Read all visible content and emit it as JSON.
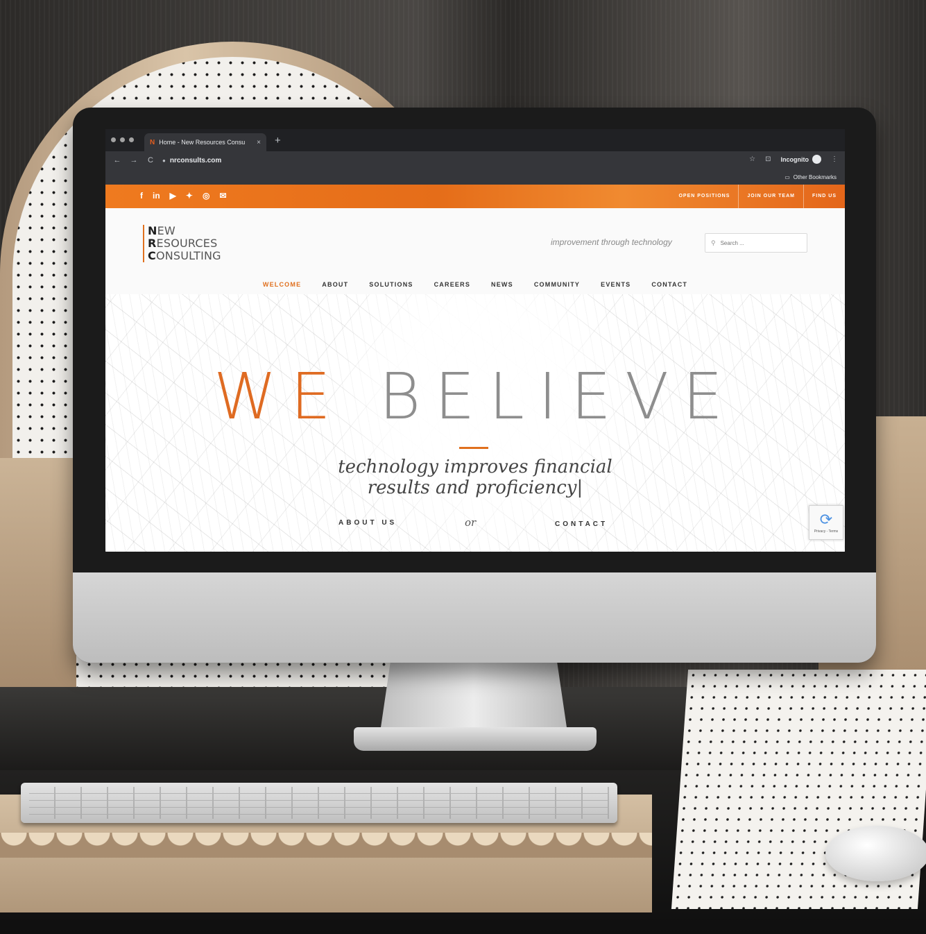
{
  "browser": {
    "tab_favicon": "N",
    "tab_title": "Home - New Resources Consu",
    "tab_close": "×",
    "new_tab": "+",
    "back": "←",
    "forward": "→",
    "reload": "C",
    "url": "nrconsults.com",
    "star": "☆",
    "cast": "⊡",
    "incognito_label": "Incognito",
    "menu": "⋮",
    "bookmarks_icon": "folder-icon",
    "other_bookmarks": "Other Bookmarks"
  },
  "site": {
    "social_icons": [
      "f",
      "in",
      "▶",
      "✦",
      "◎",
      "✉"
    ],
    "top_links": [
      "OPEN POSITIONS",
      "JOIN OUR TEAM",
      "FIND US"
    ],
    "logo": {
      "line1_first": "N",
      "line1_rest": "EW",
      "line2_first": "R",
      "line2_rest": "ESOURCES",
      "line3_first": "C",
      "line3_rest": "ONSULTING"
    },
    "tagline": "improvement through technology",
    "search_placeholder": "Search ...",
    "nav": [
      "WELCOME",
      "ABOUT",
      "SOLUTIONS",
      "CAREERS",
      "NEWS",
      "COMMUNITY",
      "EVENTS",
      "CONTACT"
    ],
    "active_nav": "WELCOME",
    "hero": {
      "title_word1": "WE",
      "title_word2": "BELIEVE",
      "subtitle_line1": "technology improves financial",
      "subtitle_line2": "results and proficiency|",
      "cta_about": "ABOUT US",
      "cta_or": "or",
      "cta_contact": "CONTACT"
    },
    "recaptcha_text": "Privacy - Terms",
    "colors": {
      "accent": "#e0701e",
      "browser_dark": "#202124",
      "hero_grey": "#8e8e8e"
    }
  }
}
